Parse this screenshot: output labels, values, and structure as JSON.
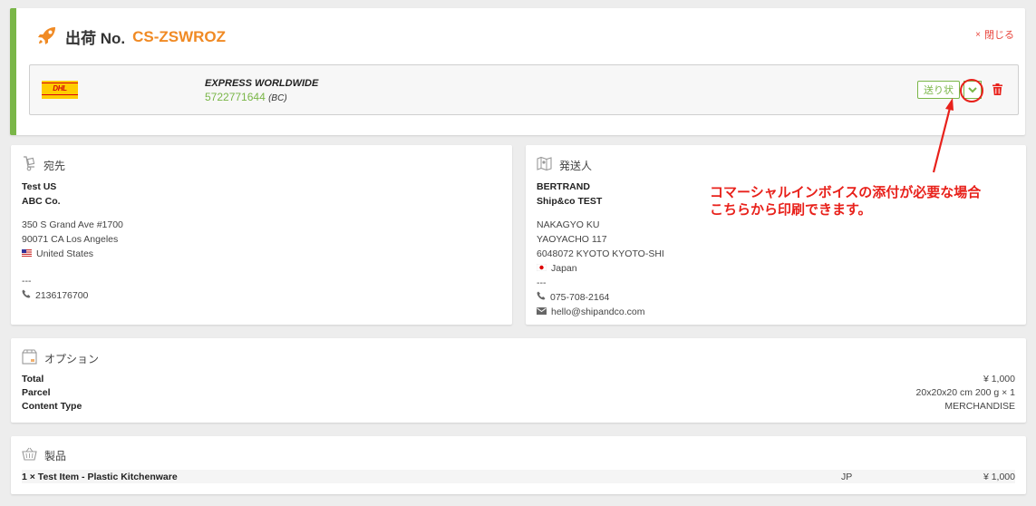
{
  "shipment": {
    "title_prefix": "出荷 No.",
    "shipment_id": "CS-ZSWROZ",
    "close_label": "閉じる",
    "carrier_logo": "DHL",
    "service_name": "EXPRESS WORLDWIDE",
    "tracking_number": "5722771644",
    "tracking_suffix": "(BC)",
    "label_button": "送り状",
    "accent_color": "#7ab648",
    "id_color": "#f08a24"
  },
  "destination": {
    "heading": "宛先",
    "name": "Test US",
    "company": "ABC Co.",
    "address1": "350 S Grand Ave #1700",
    "address2": "90071 CA Los Angeles",
    "country": "United States",
    "separator": "---",
    "phone": "2136176700"
  },
  "sender": {
    "heading": "発送人",
    "name": "BERTRAND",
    "company": "Ship&co TEST",
    "address1": "NAKAGYO KU",
    "address2": "YAOYACHO 117",
    "address3": "6048072 KYOTO KYOTO-SHI",
    "country": "Japan",
    "separator": "---",
    "phone": "075-708-2164",
    "email": "hello@shipandco.com"
  },
  "annotation": {
    "line1": "コマーシャルインボイスの添付が必要な場合",
    "line2": "こちらから印刷できます。",
    "color": "#e8211b"
  },
  "options": {
    "heading": "オプション",
    "rows": [
      {
        "key": "Total",
        "value": "¥ 1,000"
      },
      {
        "key": "Parcel",
        "value": "20x20x20 cm 200 g × 1"
      },
      {
        "key": "Content Type",
        "value": "MERCHANDISE"
      }
    ]
  },
  "products": {
    "heading": "製品",
    "items": [
      {
        "name": "1 × Test Item - Plastic Kitchenware",
        "origin": "JP",
        "price": "¥ 1,000"
      }
    ]
  }
}
